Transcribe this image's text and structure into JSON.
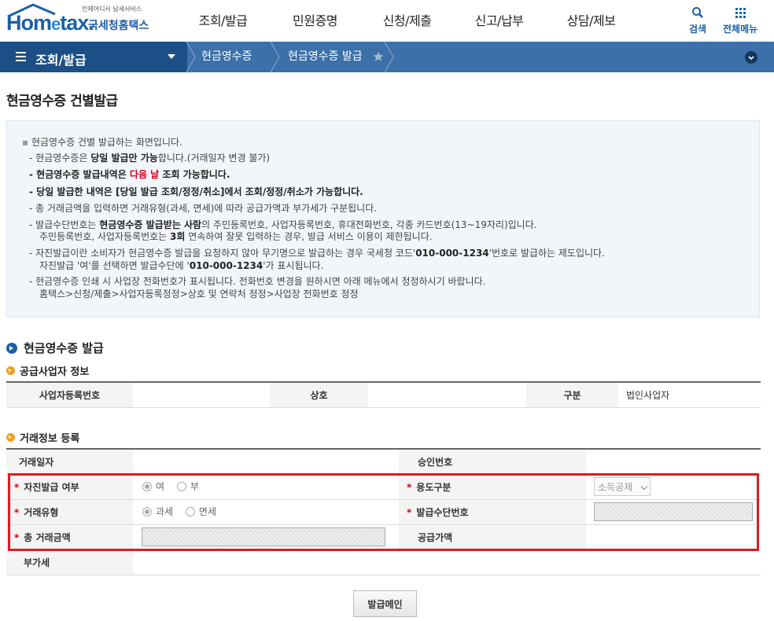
{
  "header": {
    "logo_small": "언제어디서 납세서비스",
    "logo_brand_1": "Hom",
    "logo_brand_e": "e",
    "logo_brand_2": "tax.",
    "logo_kor": "국세청홈택스",
    "menu": [
      "조회/발급",
      "민원증명",
      "신청/제출",
      "신고/납부",
      "상담/제보"
    ],
    "search_label": "검색",
    "all_menu_label": "전체메뉴"
  },
  "navbar": {
    "section": "조회/발급",
    "crumbs": [
      "현금영수증",
      "현금영수증 발급"
    ]
  },
  "page_title": "현금영수증 건별발급",
  "info": {
    "l1": "현금영수증 건별 발급하는 화면입니다.",
    "l2a": "- 현금영수증은 ",
    "l2b": "당일 발급만 가능",
    "l2c": "합니다.(거래일자 변경 불가)",
    "l3a": "- 현금영수증 발급내역은 ",
    "l3b": "다음 날",
    "l3c": " 조회 가능합니다.",
    "l4": "- 당일 발급한 내역은 [당일 발급 조회/정정/취소]에서 조회/정정/취소가 가능합니다.",
    "l5": "- 총 거래금액을 입력하면 거래유형(과세, 면세)에 따라 공급가액과 부가세가 구분됩니다.",
    "l6a": "- 발급수단번호는 ",
    "l6b": "현금영수증 발급받는 사람",
    "l6c": "의  주민등록번호, 사업자등록번호, 휴대전화번호, 각종 카드번호(13~19자리)입니다.",
    "l7a": "주민등록번호, 사업자등록번호는 ",
    "l7b": "3회",
    "l7c": " 연속하여 잘못 입력하는 경우, 발급 서비스 이용이 제한됩니다.",
    "l8a": "- 자진발급이란 소비자가 현금영수증 발급을 요청하지 않아 무기명으로 발급하는 경우 국세청 코드'",
    "l8b": "010-000-1234",
    "l8c": "'번호로 발급하는 제도입니다.",
    "l9a": "자진발급 '여'를 선택하면 발급수단에 '",
    "l9b": "010-000-1234",
    "l9c": "'가 표시됩니다.",
    "l10": "- 현금영수증 인쇄 시 사업장 전화번호가 표시됩니다. 전화번호 변경을 원하시면 아래 메뉴에서 정정하시기 바랍니다.",
    "l11": "홈택스>신청/제출>사업자등록정정>상호 및 연락처 정정>사업장 전화번호 정정"
  },
  "section_title": "현금영수증 발급",
  "supplier": {
    "title": "공급사업자 정보",
    "biz_no_label": "사업자등록번호",
    "biz_no_value": "",
    "name_label": "상호",
    "name_value": "",
    "type_label": "구분",
    "type_value": "법인사업자"
  },
  "trade": {
    "title": "거래정보 등록",
    "date_label": "거래일자",
    "date_value": "",
    "approval_label": "승인번호",
    "approval_value": "",
    "self_issue_label": "자진발급 여부",
    "self_yes": "여",
    "self_no": "부",
    "purpose_label": "용도구분",
    "purpose_value": "소득공제",
    "trade_type_label": "거래유형",
    "taxable": "과세",
    "taxfree": "면세",
    "means_label": "발급수단번호",
    "total_label": "총 거래금액",
    "supply_label": "공급가액",
    "supply_value": "",
    "vat_label": "부가세",
    "vat_value": "",
    "required_mark": "*"
  },
  "issue_button": "발급메인"
}
